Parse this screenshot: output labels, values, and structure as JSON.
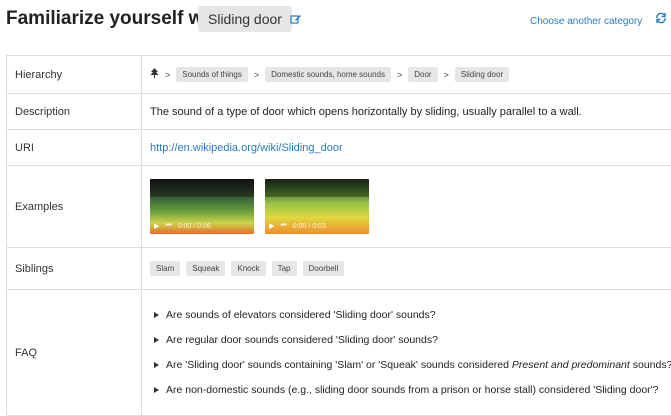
{
  "header": {
    "title": "Familiarize yourself with",
    "category": "Sliding door",
    "choose_link": "Choose another category"
  },
  "hierarchy": {
    "label": "Hierarchy",
    "crumbs": [
      "Sounds of things",
      "Domestic sounds, home sounds",
      "Door",
      "Sliding door"
    ],
    "separator": ">"
  },
  "description": {
    "label": "Description",
    "text": "The sound of a type of door which opens horizontally by sliding, usually parallel to a wall."
  },
  "uri": {
    "label": "URI",
    "url": "http://en.wikipedia.org/wiki/Sliding_door"
  },
  "examples": {
    "label": "Examples",
    "items": [
      {
        "time": "0:00 / 0:06"
      },
      {
        "time": "0:00 / 0:03"
      }
    ]
  },
  "siblings": {
    "label": "Siblings",
    "items": [
      "Slam",
      "Squeak",
      "Knock",
      "Tap",
      "Doorbell"
    ]
  },
  "faq": {
    "label": "FAQ",
    "items": [
      "Are sounds of elevators considered 'Sliding door' sounds?",
      "Are regular door sounds considered 'Sliding door' sounds?",
      "Are 'Sliding door' sounds containing 'Slam' or 'Squeak' sounds considered",
      "Are non-domestic sounds (e.g., sliding door sounds from a prison or horse stall) considered 'Sliding door'?"
    ],
    "item3_emph": "Present and predominant",
    "item3_tail": " sounds?"
  },
  "colors": {
    "link": "#2a7abf",
    "tag_bg": "#e6e6e6"
  }
}
